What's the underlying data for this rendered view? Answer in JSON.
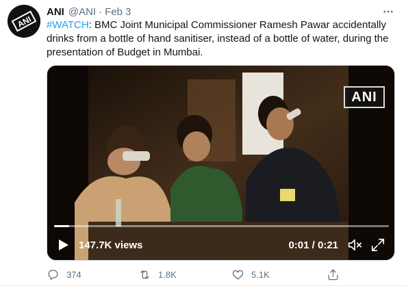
{
  "tweet": {
    "author_name": "ANI",
    "handle": "@ANI",
    "separator": "·",
    "date": "Feb 3",
    "hashtag": "#WATCH",
    "text_rest": ": BMC Joint Municipal Commissioner Ramesh Pawar accidentally drinks from a bottle of hand sanitiser, instead of a bottle of water, during the presentation of Budget in Mumbai."
  },
  "avatar": {
    "logo_text": "ANI"
  },
  "video": {
    "watermark": "ANI",
    "views": "147.7K views",
    "time": "0:01 / 0:21",
    "progress": 0.045
  },
  "actions": {
    "replies": "374",
    "retweets": "1.8K",
    "likes": "5.1K"
  },
  "colors": {
    "link": "#1da1f2",
    "muted": "#5b7083"
  },
  "icons": [
    "more-icon",
    "play-icon",
    "volume-mute-icon",
    "fullscreen-icon",
    "reply-icon",
    "retweet-icon",
    "like-icon",
    "share-icon"
  ]
}
